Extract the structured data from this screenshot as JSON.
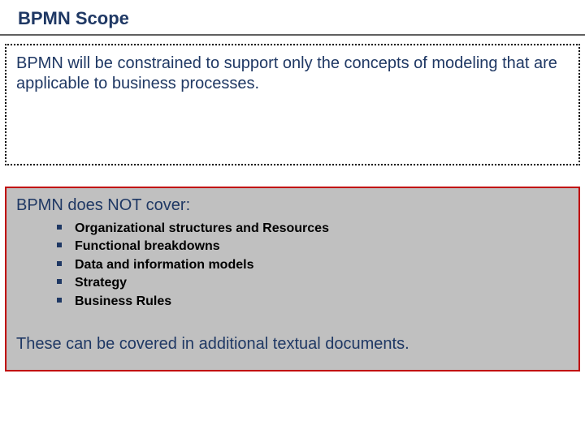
{
  "title": "BPMN Scope",
  "definition": "BPMN will be constrained to support only the concepts of modeling that are applicable to business processes.",
  "notCover": {
    "heading": "BPMN does NOT cover:",
    "items": [
      "Organizational structures and Resources",
      "Functional breakdowns",
      "Data and information models",
      "Strategy",
      "Business Rules"
    ],
    "conclusion": "These can be covered in additional textual documents."
  }
}
